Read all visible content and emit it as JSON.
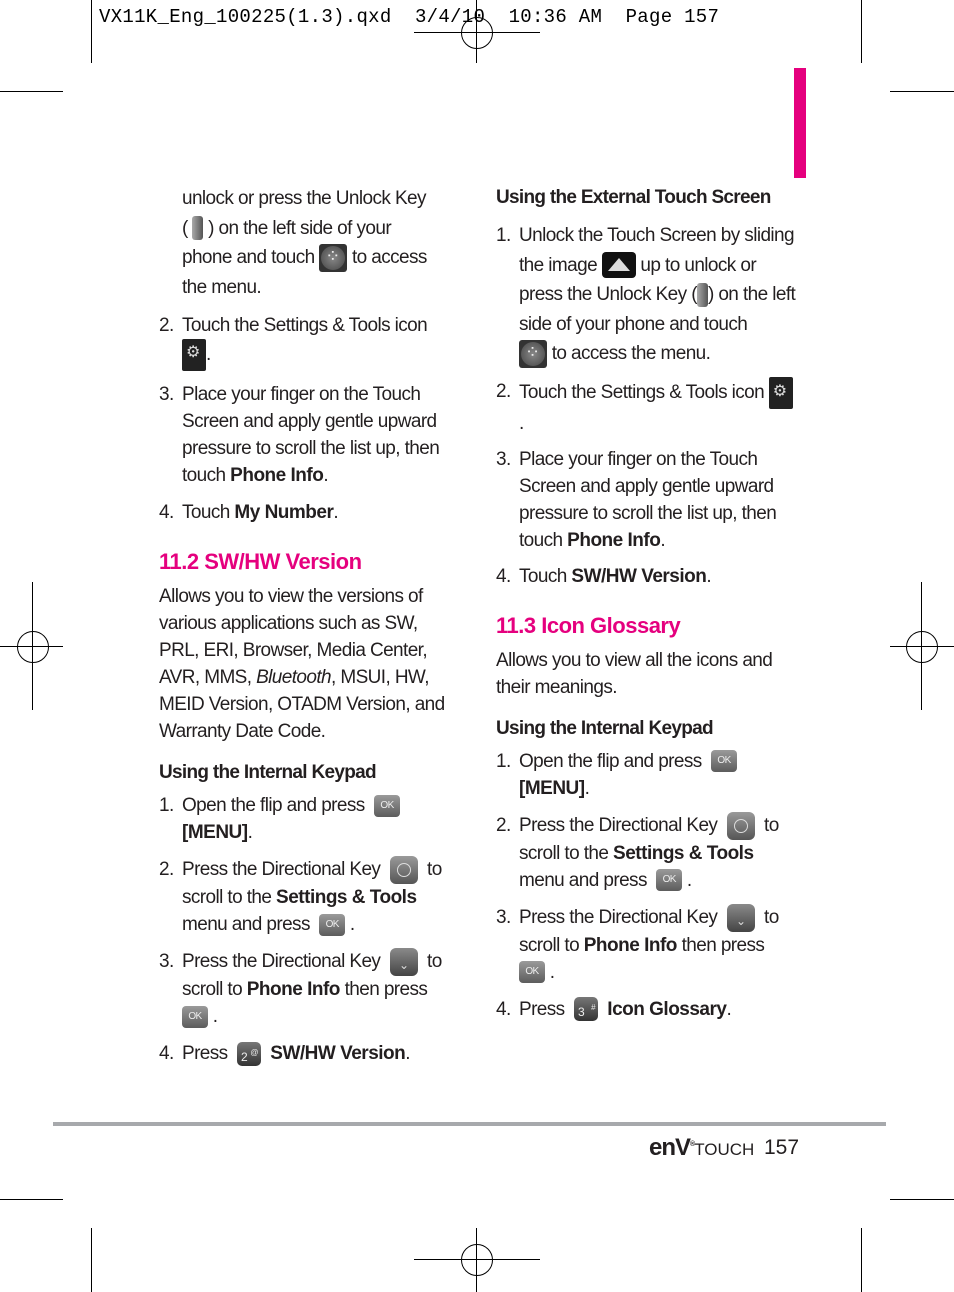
{
  "slug": "VX11K_Eng_100225(1.3).qxd  3/4/10  10:36 AM  Page 157",
  "accent_color": "#e5007e",
  "left": {
    "cont_lines": [
      "unlock or press the Unlock Key",
      "(",
      ") on the left side of your",
      "phone and touch",
      "to access",
      "the menu."
    ],
    "steps_top": [
      {
        "n": "2.",
        "text": "Touch the Settings & Tools icon",
        "tail": "."
      },
      {
        "n": "3.",
        "pre": "Place your finger on the Touch Screen and apply gentle upward pressure to scroll the list up, then touch ",
        "bold": "Phone Info",
        "post": "."
      },
      {
        "n": "4.",
        "pre": "Touch ",
        "bold": "My Number",
        "post": "."
      }
    ],
    "heading": "11.2 SW/HW Version",
    "intro_pre": "Allows you to view the versions of various applications such as SW, PRL, ERI, Browser, Media Center, AVR, MMS, ",
    "intro_italic": "Bluetooth",
    "intro_post": ", MSUI, HW, MEID Version, OTADM Version, and Warranty Date Code.",
    "subheading": "Using the Internal Keypad",
    "steps": [
      {
        "n": "1.",
        "pre": "Open the flip and press",
        "bold": "[MENU]",
        "post": "."
      },
      {
        "n": "2.",
        "pre": "Press the Directional Key",
        "mid": "to scroll to the ",
        "bold": "Settings & Tools",
        "post": " menu and press",
        "end": "."
      },
      {
        "n": "3.",
        "pre": "Press the Directional Key",
        "mid": "to scroll to ",
        "bold": "Phone Info",
        "post": " then press",
        "end": "."
      },
      {
        "n": "4.",
        "pre": "Press",
        "key": "2",
        "key_sup": "@",
        "bold": "SW/HW Version",
        "post": "."
      }
    ]
  },
  "right": {
    "subheading_ext": "Using the External Touch Screen",
    "ext_steps": [
      {
        "n": "1.",
        "a": "Unlock the Touch Screen by sliding the image",
        "b": "up to unlock or press the Unlock Key (",
        "c": ") on the left side of your phone and touch",
        "d": "to access the menu."
      },
      {
        "n": "2.",
        "text": "Touch the Settings & Tools icon",
        "tail": "."
      },
      {
        "n": "3.",
        "pre": "Place your finger on the Touch Screen and apply gentle upward pressure to scroll the list up, then touch ",
        "bold": "Phone Info",
        "post": "."
      },
      {
        "n": "4.",
        "pre": "Touch ",
        "bold": "SW/HW Version",
        "post": "."
      }
    ],
    "heading": "11.3 Icon Glossary",
    "intro": "Allows you to view all the icons and their meanings.",
    "subheading": "Using the Internal Keypad",
    "steps": [
      {
        "n": "1.",
        "pre": "Open the flip and press",
        "bold": "[MENU]",
        "post": "."
      },
      {
        "n": "2.",
        "pre": "Press the Directional Key",
        "mid": "to scroll to the ",
        "bold": "Settings & Tools",
        "post": " menu and press",
        "end": "."
      },
      {
        "n": "3.",
        "pre": "Press the Directional Key",
        "mid": "to scroll to ",
        "bold": "Phone Info",
        "post": " then press",
        "end": "."
      },
      {
        "n": "4.",
        "pre": "Press",
        "key": "3",
        "key_sup": "#",
        "bold": "Icon Glossary",
        "post": "."
      }
    ]
  },
  "icons": {
    "ok_label": "OK"
  },
  "footer": {
    "brand_main": "enV",
    "brand_sup": "®",
    "brand_touch": "TOUCH",
    "page_number": "157"
  }
}
